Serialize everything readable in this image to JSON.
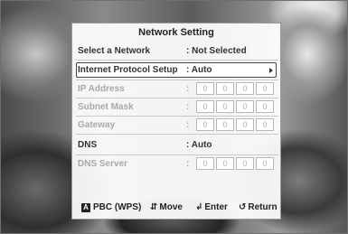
{
  "dialog": {
    "title": "Network Setting",
    "rows": [
      {
        "label": "Select a Network",
        "value": ": Not Selected"
      },
      {
        "label": "Internet Protocol Setup",
        "value": ": Auto"
      },
      {
        "label": "IP Address",
        "value": ":",
        "octets": [
          "0",
          "0",
          "0",
          "0"
        ]
      },
      {
        "label": "Subnet Mask",
        "value": ":",
        "octets": [
          "0",
          "0",
          "0",
          "0"
        ]
      },
      {
        "label": "Gateway",
        "value": ":",
        "octets": [
          "0",
          "0",
          "0",
          "0"
        ]
      },
      {
        "label": "DNS",
        "value": ": Auto"
      },
      {
        "label": "DNS Server",
        "value": ":",
        "octets": [
          "0",
          "0",
          "0",
          "0"
        ]
      }
    ]
  },
  "footer": {
    "pbc_key": "A",
    "pbc_label": "PBC (WPS)",
    "move_icon": "up-down-arrows-icon",
    "move_label": "Move",
    "enter_icon": "enter-icon",
    "enter_label": "Enter",
    "return_icon": "return-icon",
    "return_label": "Return"
  }
}
